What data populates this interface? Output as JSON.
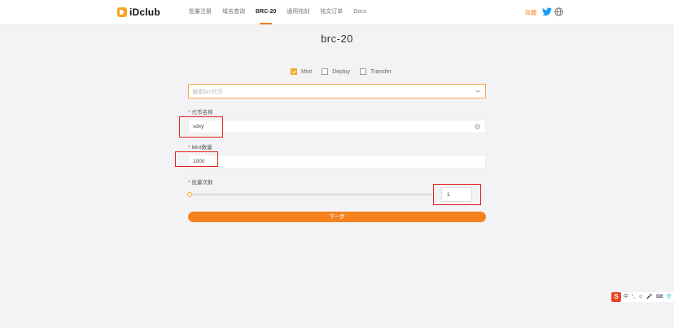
{
  "brand": {
    "name": "iDclub"
  },
  "nav": {
    "items": [
      {
        "label": "批量注册",
        "active": false
      },
      {
        "label": "域名查询",
        "active": false
      },
      {
        "label": "BRC-20",
        "active": true
      },
      {
        "label": "通用铭刻",
        "active": false
      },
      {
        "label": "铭文订单",
        "active": false
      },
      {
        "label": "Docs",
        "active": false
      }
    ],
    "lang_label": "简體",
    "twitter_icon": "twitter-icon",
    "globe_icon": "globe-icon"
  },
  "page": {
    "title": "brc-20"
  },
  "operations": [
    {
      "label": "Mint",
      "checked": true
    },
    {
      "label": "Deploy",
      "checked": false
    },
    {
      "label": "Transfer",
      "checked": false
    }
  ],
  "search_select": {
    "placeholder": "搜索brc代币"
  },
  "form": {
    "token_name": {
      "label": "代币名称",
      "value": "sdxy"
    },
    "mint_amount": {
      "label": "Mint数量",
      "value": "1000"
    },
    "batch_count": {
      "label": "批量次数",
      "value": "1",
      "slider_fraction": 0
    }
  },
  "next_button": {
    "label": "下一步"
  },
  "ime_toolbar": {
    "logo": "S",
    "items": [
      "中",
      "°,",
      "☺",
      "🎤",
      "⌨",
      "👕",
      "⋮⋮"
    ]
  },
  "colors": {
    "accent": "#f5821f",
    "highlight_box": "#e02020",
    "background": "#f3f3f5"
  }
}
